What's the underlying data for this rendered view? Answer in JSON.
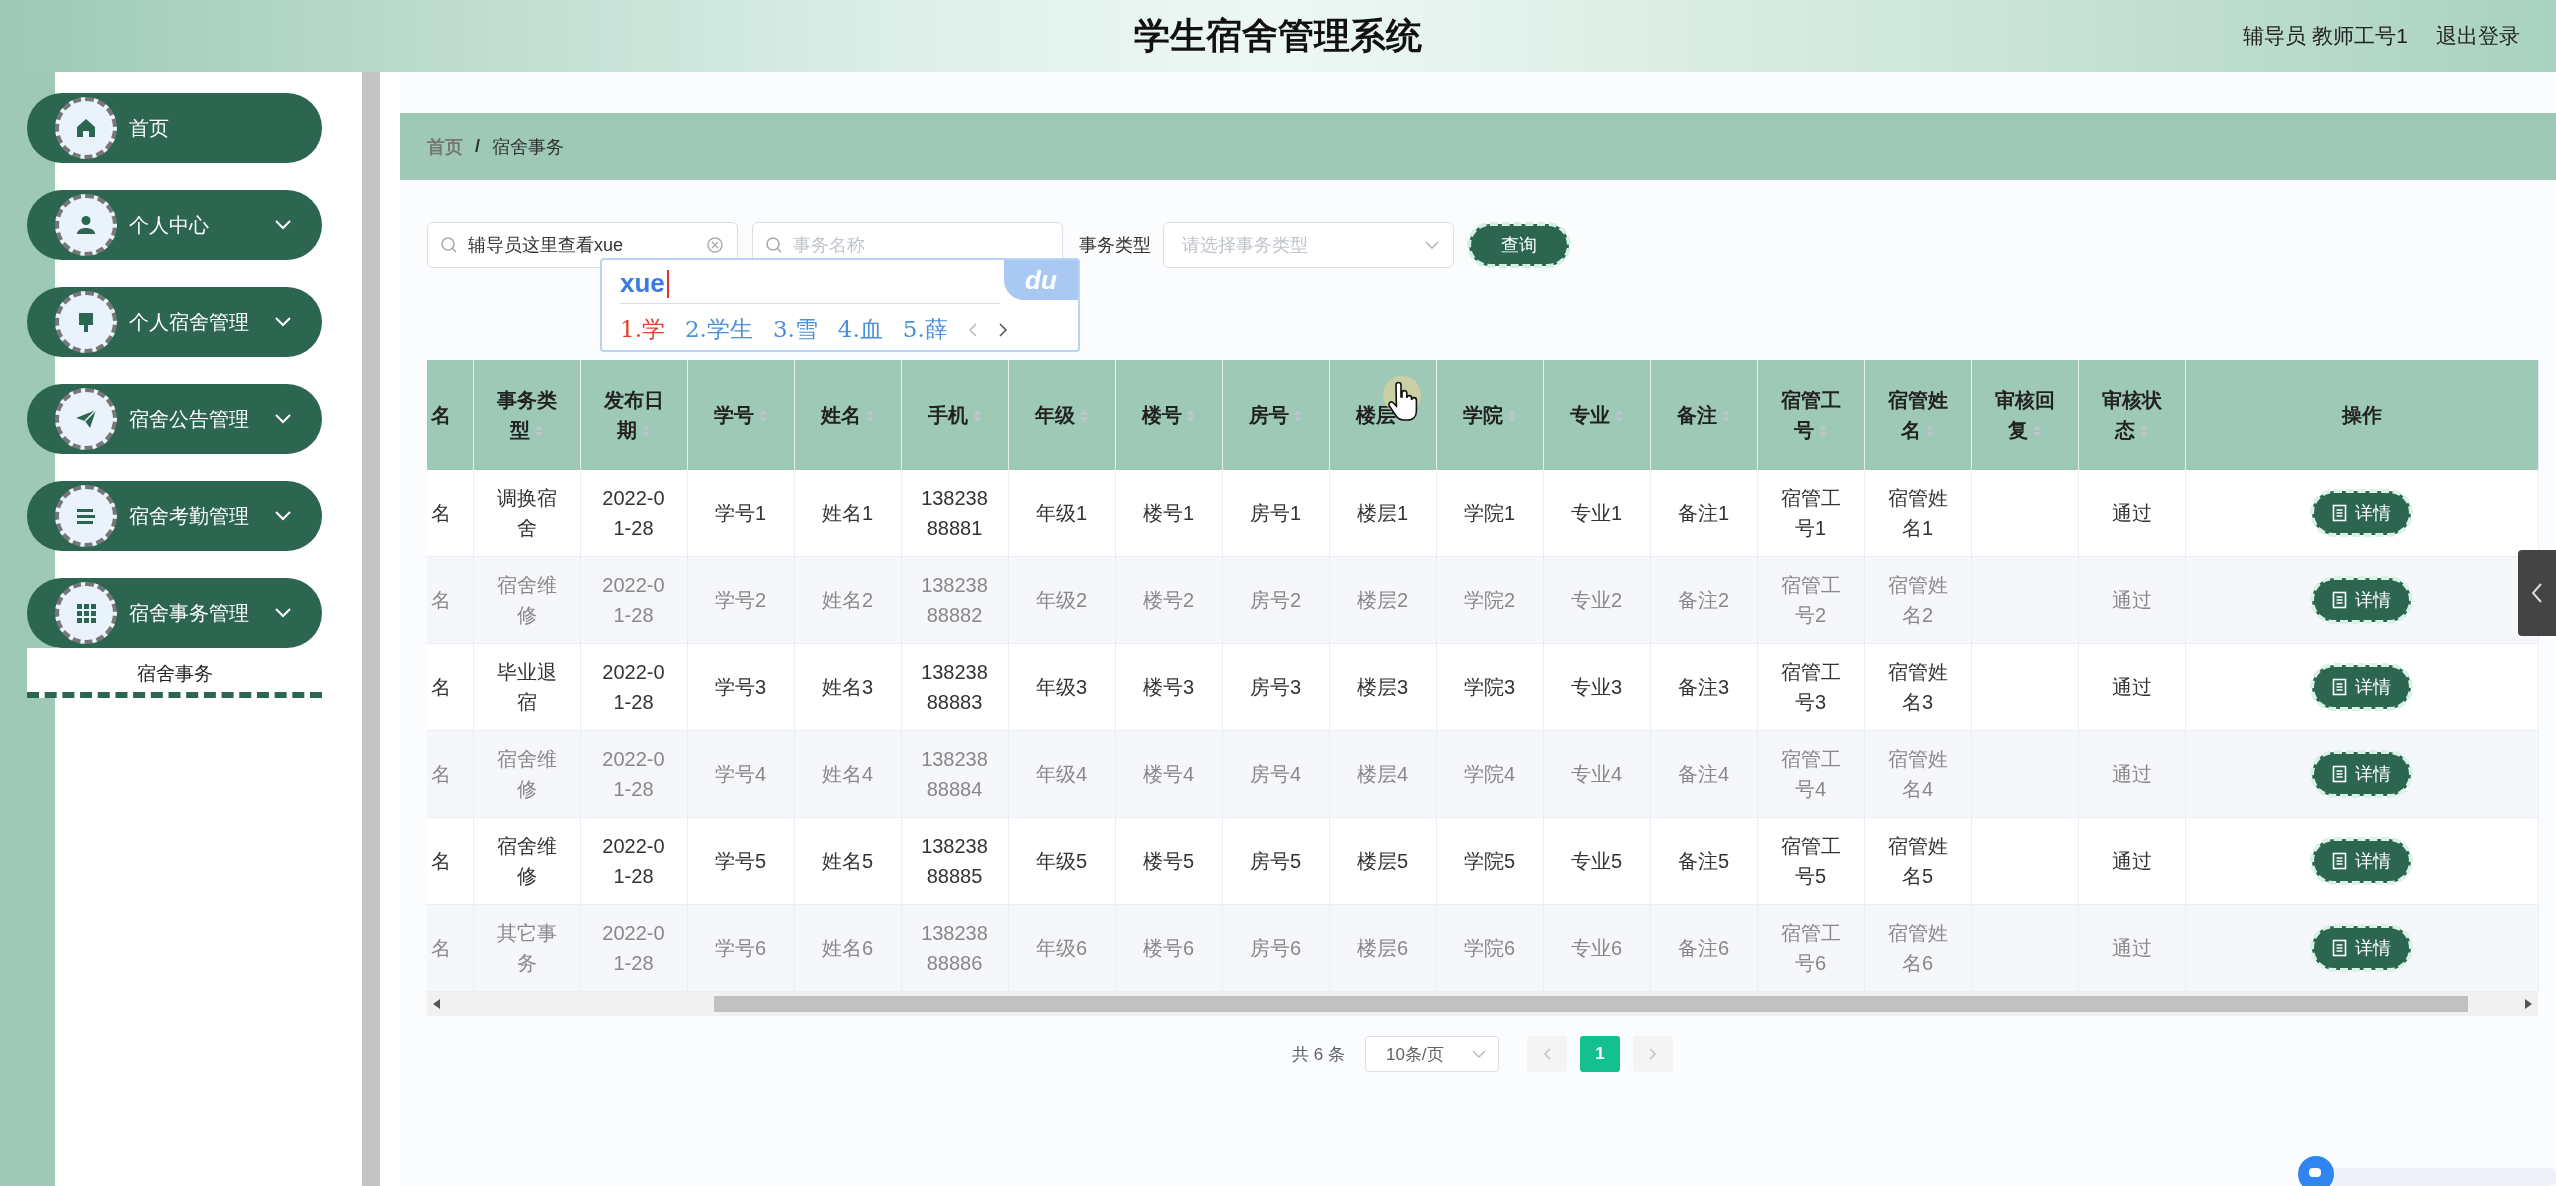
{
  "header": {
    "title": "学生宿舍管理系统",
    "user": "辅导员 教师工号1",
    "logout": "退出登录"
  },
  "sidebar": {
    "items": [
      {
        "label": "首页",
        "kind": "link"
      },
      {
        "label": "个人中心",
        "kind": "submenu"
      },
      {
        "label": "个人宿舍管理",
        "kind": "submenu"
      },
      {
        "label": "宿舍公告管理",
        "kind": "submenu"
      },
      {
        "label": "宿舍考勤管理",
        "kind": "submenu"
      },
      {
        "label": "宿舍事务管理",
        "kind": "submenu",
        "children": [
          {
            "label": "宿舍事务",
            "selected": true
          }
        ]
      }
    ]
  },
  "breadcrumb": {
    "items": [
      "首页",
      "宿舍事务"
    ],
    "separator": "/"
  },
  "search": {
    "keyword": {
      "value": "辅导员这里查看xue"
    },
    "name": {
      "placeholder": "事务名称"
    },
    "type_label": "事务类型",
    "type_select": {
      "placeholder": "请选择事务类型"
    },
    "button": "查询"
  },
  "ime": {
    "input": "xue",
    "logo": "du",
    "candidates": [
      {
        "label": "1.学",
        "selected": true
      },
      {
        "label": "2.学生",
        "selected": false
      },
      {
        "label": "3.雪",
        "selected": false
      },
      {
        "label": "4.血",
        "selected": false
      },
      {
        "label": "5.薛",
        "selected": false
      }
    ]
  },
  "table": {
    "columns": [
      {
        "label": "名",
        "sortable": false
      },
      {
        "label": "事务类型",
        "sortable": true
      },
      {
        "label": "发布日期",
        "sortable": true
      },
      {
        "label": "学号",
        "sortable": true
      },
      {
        "label": "姓名",
        "sortable": true
      },
      {
        "label": "手机",
        "sortable": true
      },
      {
        "label": "年级",
        "sortable": true
      },
      {
        "label": "楼号",
        "sortable": true
      },
      {
        "label": "房号",
        "sortable": true
      },
      {
        "label": "楼层",
        "sortable": true
      },
      {
        "label": "学院",
        "sortable": true
      },
      {
        "label": "专业",
        "sortable": true
      },
      {
        "label": "备注",
        "sortable": true
      },
      {
        "label": "宿管工号",
        "sortable": true
      },
      {
        "label": "宿管姓名",
        "sortable": true
      },
      {
        "label": "审核回复",
        "sortable": true
      },
      {
        "label": "审核状态",
        "sortable": true
      },
      {
        "label": "操作",
        "sortable": false
      }
    ],
    "rows": [
      {
        "cells": [
          "名",
          "调换宿舍",
          "2022-01-28",
          "学号1",
          "姓名1",
          "13823888881",
          "年级1",
          "楼号1",
          "房号1",
          "楼层1",
          "学院1",
          "专业1",
          "备注1",
          "宿管工号1",
          "宿管姓名1",
          null,
          "通过"
        ],
        "action": "详情"
      },
      {
        "cells": [
          "名",
          "宿舍维修",
          "2022-01-28",
          "学号2",
          "姓名2",
          "13823888882",
          "年级2",
          "楼号2",
          "房号2",
          "楼层2",
          "学院2",
          "专业2",
          "备注2",
          "宿管工号2",
          "宿管姓名2",
          null,
          "通过"
        ],
        "action": "详情"
      },
      {
        "cells": [
          "名",
          "毕业退宿",
          "2022-01-28",
          "学号3",
          "姓名3",
          "13823888883",
          "年级3",
          "楼号3",
          "房号3",
          "楼层3",
          "学院3",
          "专业3",
          "备注3",
          "宿管工号3",
          "宿管姓名3",
          null,
          "通过"
        ],
        "action": "详情"
      },
      {
        "cells": [
          "名",
          "宿舍维修",
          "2022-01-28",
          "学号4",
          "姓名4",
          "13823888884",
          "年级4",
          "楼号4",
          "房号4",
          "楼层4",
          "学院4",
          "专业4",
          "备注4",
          "宿管工号4",
          "宿管姓名4",
          null,
          "通过"
        ],
        "action": "详情"
      },
      {
        "cells": [
          "名",
          "宿舍维修",
          "2022-01-28",
          "学号5",
          "姓名5",
          "13823888885",
          "年级5",
          "楼号5",
          "房号5",
          "楼层5",
          "学院5",
          "专业5",
          "备注5",
          "宿管工号5",
          "宿管姓名5",
          null,
          "通过"
        ],
        "action": "详情"
      },
      {
        "cells": [
          "名",
          "其它事务",
          "2022-01-28",
          "学号6",
          "姓名6",
          "13823888886",
          "年级6",
          "楼号6",
          "房号6",
          "楼层6",
          "学院6",
          "专业6",
          "备注6",
          "宿管工号6",
          "宿管姓名6",
          null,
          "通过"
        ],
        "action": "详情"
      }
    ]
  },
  "pagination": {
    "total": "共 6 条",
    "page_size": "10条/页",
    "pages": [
      {
        "label": "1",
        "selected": true
      }
    ]
  }
}
